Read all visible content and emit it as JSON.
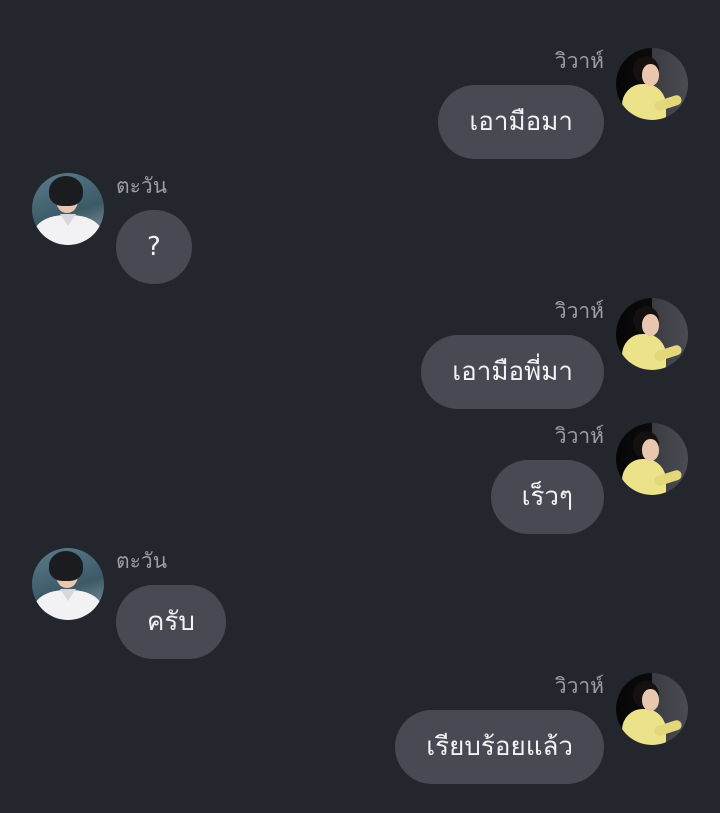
{
  "users": {
    "right": {
      "name": "วิวาห์",
      "avatar_icon": "profile-photo-yellow-shirt"
    },
    "left": {
      "name": "ตะวัน",
      "avatar_icon": "profile-photo-white-shirt"
    }
  },
  "messages": [
    {
      "sender_name": "วิวาห์",
      "side": "right",
      "text": "เอามือมา"
    },
    {
      "sender_name": "ตะวัน",
      "side": "left",
      "text": "?"
    },
    {
      "sender_name": "วิวาห์",
      "side": "right",
      "text": "เอามือพี่มา"
    },
    {
      "sender_name": "วิวาห์",
      "side": "right",
      "text": "เร็วๆ"
    },
    {
      "sender_name": "ตะวัน",
      "side": "left",
      "text": "ครับ"
    },
    {
      "sender_name": "วิวาห์",
      "side": "right",
      "text": "เรียบร้อยแล้ว"
    }
  ],
  "colors": {
    "background": "#24262d",
    "bubble": "#474a53",
    "name_text": "#9d9fa4",
    "message_text": "#f3f3f4"
  }
}
